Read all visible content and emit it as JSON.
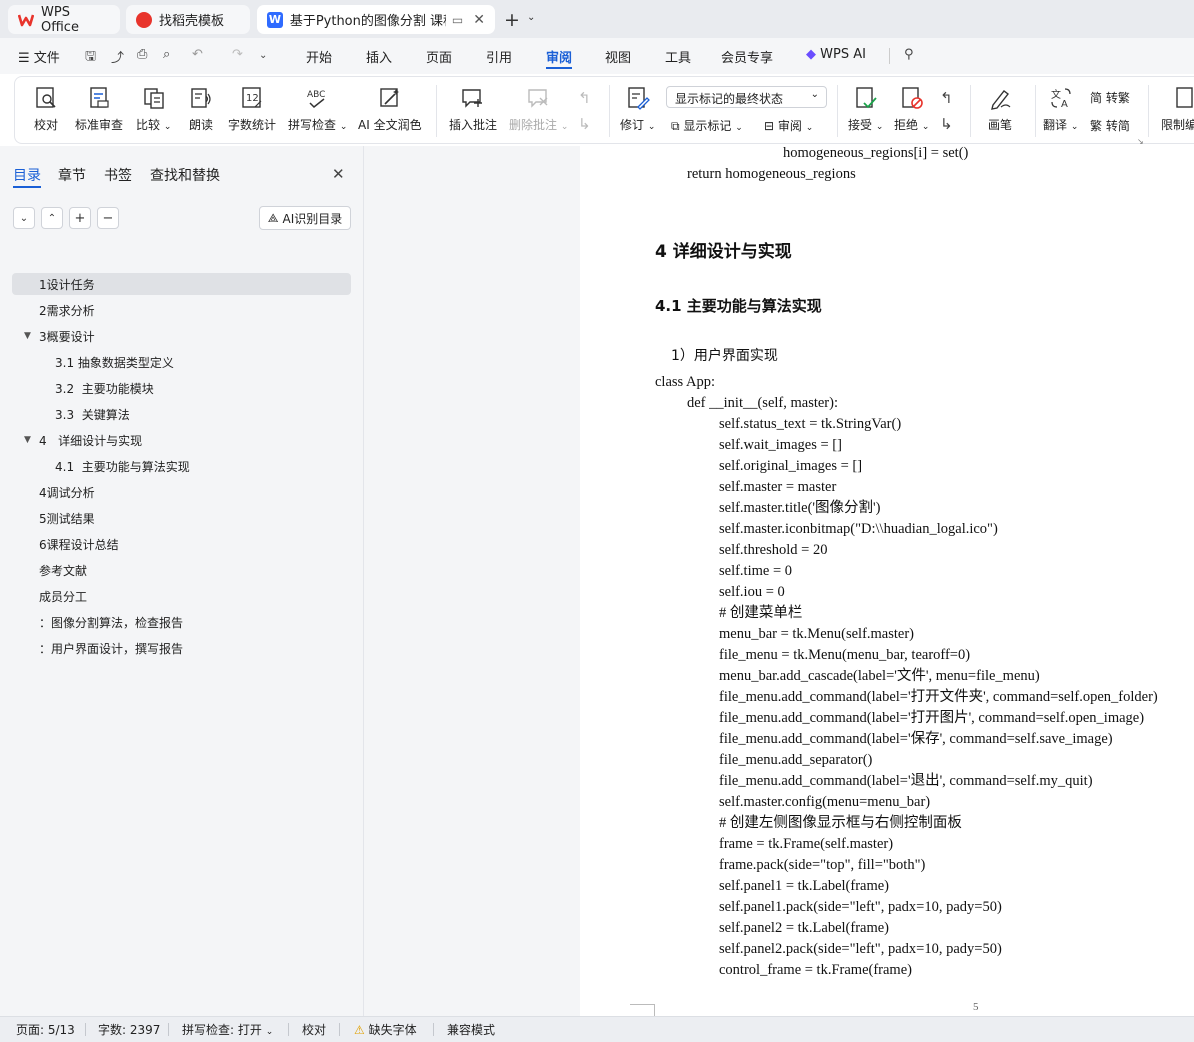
{
  "tabs": [
    {
      "label": "WPS Office",
      "color": "#e8342c"
    },
    {
      "label": "找稻壳模板",
      "color": "#e8342c"
    },
    {
      "label": "基于Python的图像分割 课程设",
      "color": "#2f6bff"
    }
  ],
  "menubar": {
    "file": "文件",
    "items": [
      "开始",
      "插入",
      "页面",
      "引用",
      "审阅",
      "视图",
      "工具",
      "会员专享"
    ],
    "active": "审阅",
    "wps_ai": "WPS AI"
  },
  "ribbon": {
    "proofread": "校对",
    "standard_review": "标准审查",
    "compare": "比较",
    "read_aloud": "朗读",
    "word_count": "字数统计",
    "spell_check": "拼写检查",
    "ai_polish": "AI 全文润色",
    "insert_comment": "插入批注",
    "delete_comment": "删除批注",
    "track": "修订",
    "markup_select": "显示标记的最终状态",
    "show_markup": "显示标记",
    "review": "审阅",
    "accept": "接受",
    "reject": "拒绝",
    "pen": "画笔",
    "translate": "翻译",
    "to_traditional": "转繁",
    "to_simplified": "转简",
    "restrict": "限制编"
  },
  "nav": {
    "tabs": [
      "目录",
      "章节",
      "书签",
      "查找和替换"
    ],
    "ai_toc": "AI识别目录",
    "items": [
      {
        "label": "1设计任务",
        "level": 0,
        "selected": true
      },
      {
        "label": "2需求分析",
        "level": 0
      },
      {
        "label": "3概要设计",
        "level": 0,
        "expanded": true
      },
      {
        "label": "3.1 抽象数据类型定义",
        "level": 1
      },
      {
        "label": "3.2  主要功能模块",
        "level": 1
      },
      {
        "label": "3.3  关键算法",
        "level": 1
      },
      {
        "label": "4   详细设计与实现",
        "level": 0,
        "expanded": true
      },
      {
        "label": "4.1  主要功能与算法实现",
        "level": 1
      },
      {
        "label": "4调试分析",
        "level": 0
      },
      {
        "label": "5测试结果",
        "level": 0
      },
      {
        "label": "6课程设计总结",
        "level": 0
      },
      {
        "label": "参考文献",
        "level": 0
      },
      {
        "label": "成员分工",
        "level": 0
      },
      {
        "label": "：图像分割算法，检查报告",
        "level": 0
      },
      {
        "label": "：用户界面设计，撰写报告",
        "level": 0
      }
    ]
  },
  "doc": {
    "heading1": "4   详细设计与实现",
    "heading2": "4.1  主要功能与算法实现",
    "subtitle": "1）用户界面实现",
    "page_number": "5",
    "pre_lines": [
      {
        "indent": 2,
        "text": "homogeneous_regions[i] = set()"
      },
      {
        "indent": 1,
        "text": "return homogeneous_regions"
      }
    ],
    "code_lines": [
      {
        "indent": 0,
        "text": "class App:"
      },
      {
        "indent": 1,
        "text": "def __init__(self, master):"
      },
      {
        "indent": 2,
        "text": "self.status_text = tk.StringVar()"
      },
      {
        "indent": 2,
        "text": "self.wait_images = []"
      },
      {
        "indent": 2,
        "text": "self.original_images = []"
      },
      {
        "indent": 2,
        "text": "self.master = master"
      },
      {
        "indent": 2,
        "text": "self.master.title('图像分割')"
      },
      {
        "indent": 2,
        "text": "self.master.iconbitmap(\"D:\\\\huadian_logal.ico\")"
      },
      {
        "indent": 2,
        "text": "self.threshold = 20"
      },
      {
        "indent": 2,
        "text": "self.time = 0"
      },
      {
        "indent": 2,
        "text": "self.iou = 0"
      },
      {
        "indent": 2,
        "text": "# 创建菜单栏"
      },
      {
        "indent": 2,
        "text": "menu_bar = tk.Menu(self.master)"
      },
      {
        "indent": 2,
        "text": "file_menu = tk.Menu(menu_bar, tearoff=0)"
      },
      {
        "indent": 2,
        "text": "menu_bar.add_cascade(label='文件', menu=file_menu)"
      },
      {
        "indent": 2,
        "text": "file_menu.add_command(label='打开文件夹', command=self.open_folder)"
      },
      {
        "indent": 2,
        "text": "file_menu.add_command(label='打开图片', command=self.open_image)"
      },
      {
        "indent": 2,
        "text": "file_menu.add_command(label='保存', command=self.save_image)"
      },
      {
        "indent": 2,
        "text": "file_menu.add_separator()"
      },
      {
        "indent": 2,
        "text": "file_menu.add_command(label='退出', command=self.my_quit)"
      },
      {
        "indent": 2,
        "text": "self.master.config(menu=menu_bar)"
      },
      {
        "indent": 2,
        "text": "# 创建左侧图像显示框与右侧控制面板"
      },
      {
        "indent": 2,
        "text": "frame = tk.Frame(self.master)"
      },
      {
        "indent": 2,
        "text": "frame.pack(side=\"top\", fill=\"both\")"
      },
      {
        "indent": 2,
        "text": "self.panel1 = tk.Label(frame)"
      },
      {
        "indent": 2,
        "text": "self.panel1.pack(side=\"left\", padx=10, pady=50)"
      },
      {
        "indent": 2,
        "text": "self.panel2 = tk.Label(frame)"
      },
      {
        "indent": 2,
        "text": "self.panel2.pack(side=\"left\", padx=10, pady=50)"
      },
      {
        "indent": 2,
        "text": "control_frame = tk.Frame(frame)"
      }
    ]
  },
  "status": {
    "page": "页面: 5/13",
    "words": "字数: 2397",
    "spell": "拼写检查: 打开",
    "proof": "校对",
    "missing_font": "缺失字体",
    "compat": "兼容模式"
  }
}
